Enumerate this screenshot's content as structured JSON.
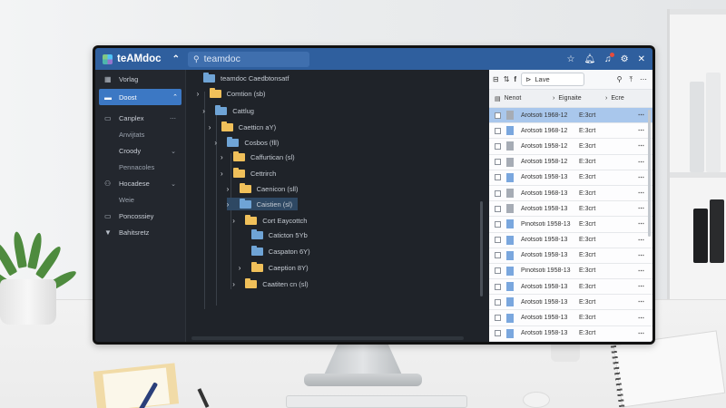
{
  "app": {
    "brand": "teAMdoc",
    "search_value": "teamdoc",
    "accent": "#2f5f9e",
    "selected_color": "#3c78c4"
  },
  "titlebar_icons": [
    "star-icon",
    "bell-icon",
    "notifications-icon",
    "gear-icon",
    "close-icon"
  ],
  "sidebar": {
    "items": [
      {
        "label": "Vorlag",
        "icon": "grid-icon",
        "type": "main"
      },
      {
        "label": "Doost",
        "icon": "folder-icon",
        "type": "active"
      },
      {
        "label": "Canplex",
        "icon": "doc-icon",
        "type": "main"
      },
      {
        "label": "Anvijtats",
        "icon": "",
        "type": "sub"
      },
      {
        "label": "Croody",
        "icon": "",
        "type": "main"
      },
      {
        "label": "Pennacoles",
        "icon": "",
        "type": "sub"
      },
      {
        "label": "Hocadese",
        "icon": "people-icon",
        "type": "main"
      },
      {
        "label": "Weie",
        "icon": "gear-icon",
        "type": "sub"
      },
      {
        "label": "Poncossiey",
        "icon": "doc-icon",
        "type": "main"
      },
      {
        "label": "Bahitsretz",
        "icon": "bookmark-icon",
        "type": "main"
      }
    ]
  },
  "tree": {
    "rows": [
      {
        "label": "teamdoc Caedbtonsatf",
        "color": "b",
        "chevron": false,
        "level": 0
      },
      {
        "label": "Comtion (sb)",
        "color": "y",
        "chevron": true,
        "level": 1
      },
      {
        "label": "Cattlug",
        "color": "b",
        "chevron": true,
        "level": 2
      },
      {
        "label": "Caetticn aY)",
        "color": "y",
        "chevron": true,
        "level": 3
      },
      {
        "label": "Cosbos (fll)",
        "color": "b",
        "chevron": true,
        "level": 4
      },
      {
        "label": "Caffurtican (sl)",
        "color": "y",
        "chevron": true,
        "level": 5
      },
      {
        "label": "Cettrirch",
        "color": "y",
        "chevron": true,
        "level": 5
      },
      {
        "label": "Caenicon (sll)",
        "color": "y",
        "chevron": true,
        "level": 6
      },
      {
        "label": "Caistien (sl)",
        "color": "b",
        "chevron": true,
        "level": 6,
        "selected": true
      },
      {
        "label": "Cort Eaycottch",
        "color": "y",
        "chevron": true,
        "level": 7
      },
      {
        "label": "Caticton 5Yb",
        "color": "b",
        "chevron": false,
        "level": 8
      },
      {
        "label": "Caspaton 6Y)",
        "color": "b",
        "chevron": false,
        "level": 8
      },
      {
        "label": "Caeption 8Y)",
        "color": "y",
        "chevron": true,
        "level": 8
      },
      {
        "label": "Caatiten cn (sl)",
        "color": "y",
        "chevron": true,
        "level": 7
      }
    ]
  },
  "panel": {
    "toolbar": {
      "pill_label": "Lave"
    },
    "headers": {
      "name": "Nenot",
      "size": "Eignaite",
      "date": "Ecre"
    },
    "rows": [
      {
        "name": "Arotsoti 1968-12",
        "type": "E:3crt",
        "doc": "g",
        "selected": true
      },
      {
        "name": "Arotsoti 1968-12",
        "type": "E:3crt",
        "doc": "b"
      },
      {
        "name": "Arotsoti 1958-12",
        "type": "E:3crt",
        "doc": "g"
      },
      {
        "name": "Arotsoti 1958-12",
        "type": "E:3crt",
        "doc": "g"
      },
      {
        "name": "Arotsoti 1958-13",
        "type": "E:3crt",
        "doc": "b"
      },
      {
        "name": "Arotsoti 1968-13",
        "type": "E:3crt",
        "doc": "g"
      },
      {
        "name": "Arotsoti 1958-13",
        "type": "E:3crt",
        "doc": "g"
      },
      {
        "name": "Pinotsoti 1958-13",
        "type": "E:3crt",
        "doc": "b"
      },
      {
        "name": "Arotsoti 1958-13",
        "type": "E:3crt",
        "doc": "b"
      },
      {
        "name": "Arotsoti 1958-13",
        "type": "E:3crt",
        "doc": "b"
      },
      {
        "name": "Pinotsoti 1958-13",
        "type": "E:3crt",
        "doc": "b"
      },
      {
        "name": "Arotsoti 1958-13",
        "type": "E:3crt",
        "doc": "b"
      },
      {
        "name": "Arotsoti 1958-13",
        "type": "E:3crt",
        "doc": "b"
      },
      {
        "name": "Arotsoti 1958-13",
        "type": "E:3crt",
        "doc": "b"
      },
      {
        "name": "Arotsoti 1958-13",
        "type": "E:3crt",
        "doc": "b"
      }
    ]
  }
}
